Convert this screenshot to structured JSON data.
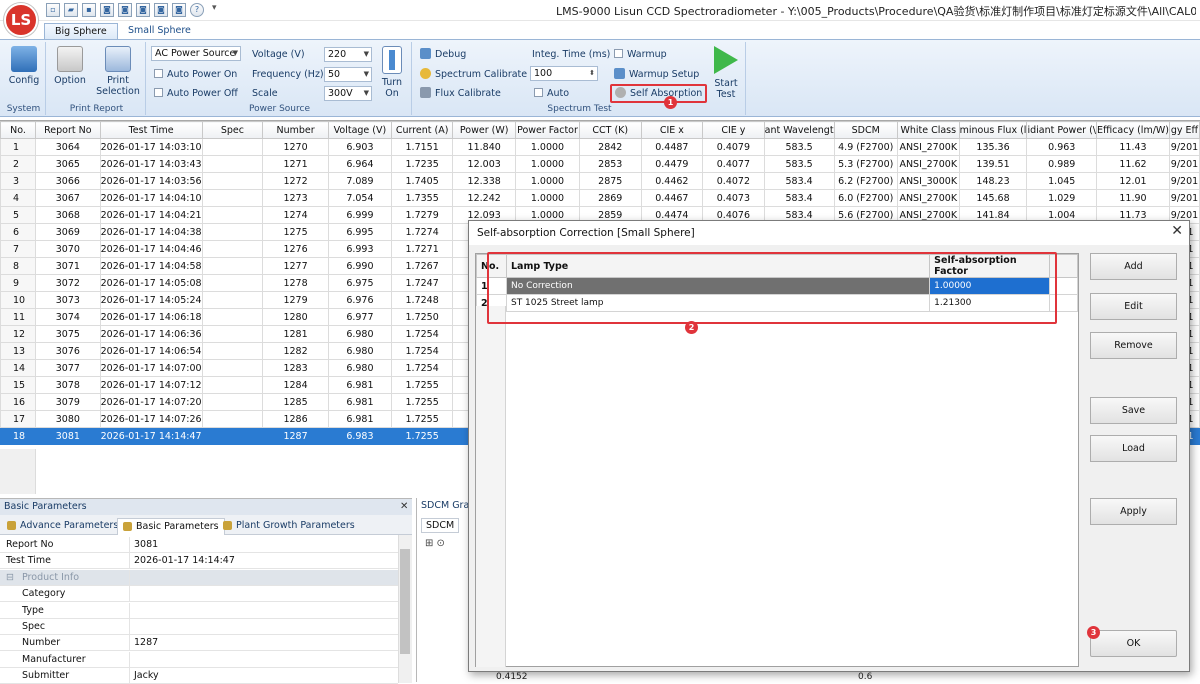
{
  "app": {
    "title": "LMS-9000 Lisun CCD Spectroradiometer - Y:\\005_Products\\Procedure\\QA验货\\标准灯制作项目\\标准灯定标源文件\\All\\CAL03B0086-",
    "logo": "LS"
  },
  "ribbon": {
    "tabs": [
      "Big Sphere",
      "Small Sphere"
    ],
    "system": {
      "config": "Config",
      "label": "System"
    },
    "print": {
      "option": "Option",
      "print_selection": "Print Selection",
      "label": "Print Report"
    },
    "power": {
      "source": "AC Power Source",
      "auto_on": "Auto Power On",
      "auto_off": "Auto Power Off",
      "voltage_label": "Voltage (V)",
      "voltage": "220",
      "frequency_label": "Frequency (Hz)",
      "frequency": "50",
      "scale_label": "Scale",
      "scale": "300V",
      "turn_on": "Turn On",
      "label": "Power Source"
    },
    "spectrum": {
      "debug": "Debug",
      "spectrum_calibrate": "Spectrum Calibrate",
      "flux_calibrate": "Flux Calibrate",
      "integ_label": "Integ. Time (ms)",
      "integ": "100",
      "auto": "Auto",
      "warmup": "Warmup",
      "warmup_setup": "Warmup Setup",
      "self_absorption": "Self Absorption",
      "start_test": "Start Test",
      "label": "Spectrum Test"
    },
    "badges": [
      "1",
      "2",
      "3"
    ]
  },
  "grid": {
    "columns": [
      "No.",
      "Report No",
      "Test Time",
      "Spec",
      "Number",
      "Voltage (V)",
      "Current (A)",
      "Power (W)",
      "Power Factor",
      "CCT (K)",
      "CIE x",
      "CIE y",
      "ant Wavelengt",
      "SDCM",
      "White Class",
      "minous Flux (l",
      "idiant Power (\\",
      "Efficacy (lm/W)",
      "gy Eff"
    ],
    "rows": [
      [
        "1",
        "3064",
        "2026-01-17 14:03:10",
        "",
        "1270",
        "6.903",
        "1.7151",
        "11.840",
        "1.0000",
        "2842",
        "0.4487",
        "0.4079",
        "583.5",
        "4.9 (F2700)",
        "ANSI_2700K",
        "135.36",
        "0.963",
        "11.43",
        "9/201"
      ],
      [
        "2",
        "3065",
        "2026-01-17 14:03:43",
        "",
        "1271",
        "6.964",
        "1.7235",
        "12.003",
        "1.0000",
        "2853",
        "0.4479",
        "0.4077",
        "583.5",
        "5.3 (F2700)",
        "ANSI_2700K",
        "139.51",
        "0.989",
        "11.62",
        "9/201"
      ],
      [
        "3",
        "3066",
        "2026-01-17 14:03:56",
        "",
        "1272",
        "7.089",
        "1.7405",
        "12.338",
        "1.0000",
        "2875",
        "0.4462",
        "0.4072",
        "583.4",
        "6.2 (F2700)",
        "ANSI_3000K",
        "148.23",
        "1.045",
        "12.01",
        "9/201"
      ],
      [
        "4",
        "3067",
        "2026-01-17 14:04:10",
        "",
        "1273",
        "7.054",
        "1.7355",
        "12.242",
        "1.0000",
        "2869",
        "0.4467",
        "0.4073",
        "583.4",
        "6.0 (F2700)",
        "ANSI_2700K",
        "145.68",
        "1.029",
        "11.90",
        "9/201"
      ],
      [
        "5",
        "3068",
        "2026-01-17 14:04:21",
        "",
        "1274",
        "6.999",
        "1.7279",
        "12.093",
        "1.0000",
        "2859",
        "0.4474",
        "0.4076",
        "583.4",
        "5.6 (F2700)",
        "ANSI_2700K",
        "141.84",
        "1.004",
        "11.73",
        "9/201"
      ],
      [
        "6",
        "3069",
        "2026-01-17 14:04:38",
        "",
        "1275",
        "6.995",
        "1.7274",
        "",
        "",
        "",
        "",
        "",
        "",
        "",
        "",
        "",
        "",
        "",
        "201"
      ],
      [
        "7",
        "3070",
        "2026-01-17 14:04:46",
        "",
        "1276",
        "6.993",
        "1.7271",
        "",
        "",
        "",
        "",
        "",
        "",
        "",
        "",
        "",
        "",
        "",
        "201"
      ],
      [
        "8",
        "3071",
        "2026-01-17 14:04:58",
        "",
        "1277",
        "6.990",
        "1.7267",
        "",
        "",
        "",
        "",
        "",
        "",
        "",
        "",
        "",
        "",
        "",
        "201"
      ],
      [
        "9",
        "3072",
        "2026-01-17 14:05:08",
        "",
        "1278",
        "6.975",
        "1.7247",
        "",
        "",
        "",
        "",
        "",
        "",
        "",
        "",
        "",
        "",
        "",
        "201"
      ],
      [
        "10",
        "3073",
        "2026-01-17 14:05:24",
        "",
        "1279",
        "6.976",
        "1.7248",
        "",
        "",
        "",
        "",
        "",
        "",
        "",
        "",
        "",
        "",
        "",
        "201"
      ],
      [
        "11",
        "3074",
        "2026-01-17 14:06:18",
        "",
        "1280",
        "6.977",
        "1.7250",
        "",
        "",
        "",
        "",
        "",
        "",
        "",
        "",
        "",
        "",
        "",
        "201"
      ],
      [
        "12",
        "3075",
        "2026-01-17 14:06:36",
        "",
        "1281",
        "6.980",
        "1.7254",
        "",
        "",
        "",
        "",
        "",
        "",
        "",
        "",
        "",
        "",
        "",
        "201"
      ],
      [
        "13",
        "3076",
        "2026-01-17 14:06:54",
        "",
        "1282",
        "6.980",
        "1.7254",
        "",
        "",
        "",
        "",
        "",
        "",
        "",
        "",
        "",
        "",
        "",
        "201"
      ],
      [
        "14",
        "3077",
        "2026-01-17 14:07:00",
        "",
        "1283",
        "6.980",
        "1.7254",
        "",
        "",
        "",
        "",
        "",
        "",
        "",
        "",
        "",
        "",
        "",
        "201"
      ],
      [
        "15",
        "3078",
        "2026-01-17 14:07:12",
        "",
        "1284",
        "6.981",
        "1.7255",
        "",
        "",
        "",
        "",
        "",
        "",
        "",
        "",
        "",
        "",
        "",
        "201"
      ],
      [
        "16",
        "3079",
        "2026-01-17 14:07:20",
        "",
        "1285",
        "6.981",
        "1.7255",
        "",
        "",
        "",
        "",
        "",
        "",
        "",
        "",
        "",
        "",
        "",
        "201"
      ],
      [
        "17",
        "3080",
        "2026-01-17 14:07:26",
        "",
        "1286",
        "6.981",
        "1.7255",
        "",
        "",
        "",
        "",
        "",
        "",
        "",
        "",
        "",
        "",
        "",
        "201"
      ],
      [
        "18",
        "3081",
        "2026-01-17 14:14:47",
        "",
        "1287",
        "6.983",
        "1.7255",
        "",
        "",
        "",
        "",
        "",
        "",
        "",
        "",
        "",
        "",
        "",
        "201"
      ]
    ]
  },
  "basic_params": {
    "title": "Basic Parameters",
    "tabs": [
      "Advance Parameters",
      "Basic Parameters",
      "Plant Growth Parameters"
    ],
    "rows": [
      {
        "k": "Report No",
        "v": "3081"
      },
      {
        "k": "Test Time",
        "v": "2026-01-17 14:14:47"
      },
      {
        "k": "Product Info",
        "v": ""
      },
      {
        "k": "Category",
        "v": ""
      },
      {
        "k": "Type",
        "v": ""
      },
      {
        "k": "Spec",
        "v": ""
      },
      {
        "k": "Number",
        "v": "1287"
      },
      {
        "k": "Manufacturer",
        "v": ""
      },
      {
        "k": "Submitter",
        "v": "Jacky"
      }
    ]
  },
  "sdcm_panel": {
    "title": "SDCM Grap",
    "tab": "SDCM",
    "value_left": "0.4152",
    "value_right": "0.6"
  },
  "dialog": {
    "title": "Self-absorption Correction [Small Sphere]",
    "columns": [
      "No.",
      "Lamp Type",
      "Self-absorption Factor"
    ],
    "rows": [
      {
        "no": "1",
        "lamp": "No Correction",
        "factor": "1.00000"
      },
      {
        "no": "2",
        "lamp": "ST 1025 Street lamp",
        "factor": "1.21300"
      }
    ],
    "buttons": {
      "add": "Add",
      "edit": "Edit",
      "remove": "Remove",
      "save": "Save",
      "load": "Load",
      "apply": "Apply",
      "ok": "OK"
    }
  }
}
